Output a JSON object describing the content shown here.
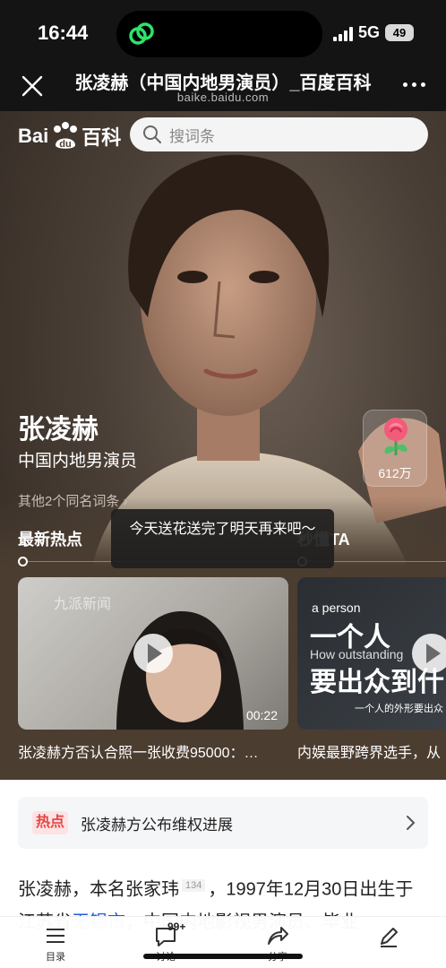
{
  "status": {
    "time": "16:44",
    "network": "5G",
    "battery": "49"
  },
  "nav": {
    "title": "张凌赫（中国内地男演员）_百度百科",
    "url": "baike.baidu.com"
  },
  "header": {
    "logo_left": "Bai",
    "logo_right": "百科",
    "search_placeholder": "搜词条"
  },
  "person": {
    "name": "张凌赫",
    "description": "中国内地男演员",
    "same_name_link": "其他2个同名词条 ›",
    "flower_count": "612万"
  },
  "tabs": [
    {
      "label": "最新热点"
    },
    {
      "label": "秒懂TA"
    }
  ],
  "videos": [
    {
      "title": "张凌赫方否认合照一张收费95000：…",
      "duration": "00:22",
      "overlay": "九派新闻"
    },
    {
      "title": "内娱最野跨界选手，从",
      "overlay_small": "a person",
      "overlay_big1": "一个人",
      "overlay_sub": "How outstanding",
      "overlay_big2": "要出众到什",
      "overlay_caption": "一个人的外形要出众"
    }
  ],
  "toast": "今天送花送完了明天再来吧～",
  "hot": {
    "badge": "热点",
    "text": "张凌赫方公布维权进展"
  },
  "intro": {
    "part1": "张凌赫，本名张家玮",
    "ref": "134",
    "part2": "，1997年12月30日出生于江苏省",
    "link": "无锡市",
    "part3": "，中国内地影视男演员、毕业"
  },
  "bottom_bar": [
    {
      "label": "目录",
      "icon": "list-icon"
    },
    {
      "label": "讨论",
      "icon": "comment-icon",
      "badge": "99+"
    },
    {
      "label": "分享",
      "icon": "share-icon"
    },
    {
      "label": "",
      "icon": "edit-icon"
    }
  ],
  "colors": {
    "hero_bg": "#4b3d30",
    "hot_red": "#e64545",
    "link_blue": "#1e5bd8"
  }
}
